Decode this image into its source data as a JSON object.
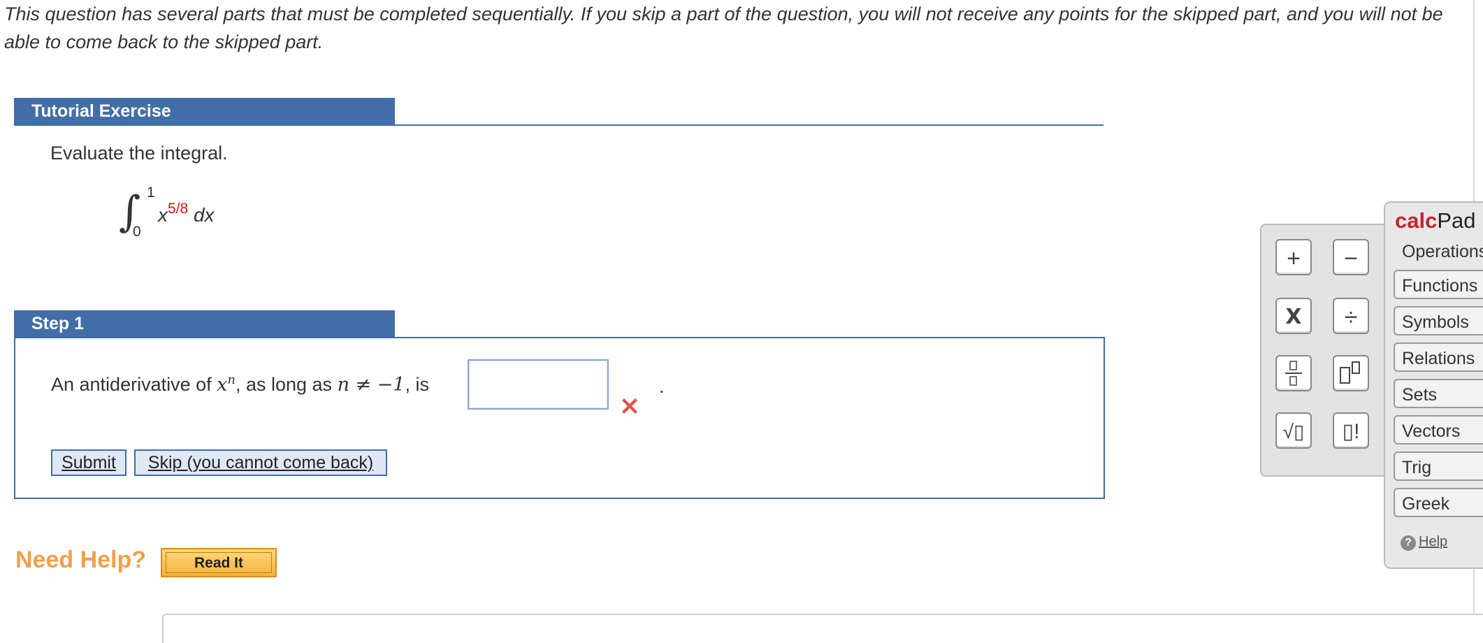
{
  "intro": "This question has several parts that must be completed sequentially. If you skip a part of the question, you will not receive any points for the skipped part, and you will not be able to come back to the skipped part.",
  "tutorial": {
    "header": "Tutorial Exercise",
    "prompt": "Evaluate the integral.",
    "integral": {
      "upper": "1",
      "lower": "0",
      "base": "x",
      "exponent": "5/8",
      "differential": "dx"
    }
  },
  "step1": {
    "header": "Step 1",
    "text_before": "An antiderivative of ",
    "var": "x",
    "sup": "n",
    "text_mid": ", as long as ",
    "condition": "n ≠ −1",
    "text_after": ", is",
    "answer_value": "",
    "period": ".",
    "submit_label": "Submit",
    "skip_label": "Skip (you cannot come back)"
  },
  "help": {
    "label": "Need Help?",
    "read_it_label": "Read It"
  },
  "calcpad": {
    "title_bold": "calc",
    "title_rest": "Pad",
    "active_tab": "Operations",
    "tabs": [
      "Functions",
      "Symbols",
      "Relations",
      "Sets",
      "Vectors",
      "Trig",
      "Greek"
    ],
    "help_label": "Help",
    "ops": [
      "+",
      "−",
      "X",
      "÷",
      "fraction",
      "power",
      "√▯",
      "▯!"
    ]
  },
  "colors": {
    "accent": "#416ea6",
    "error": "#e05050",
    "help_orange": "#f0a04b"
  }
}
